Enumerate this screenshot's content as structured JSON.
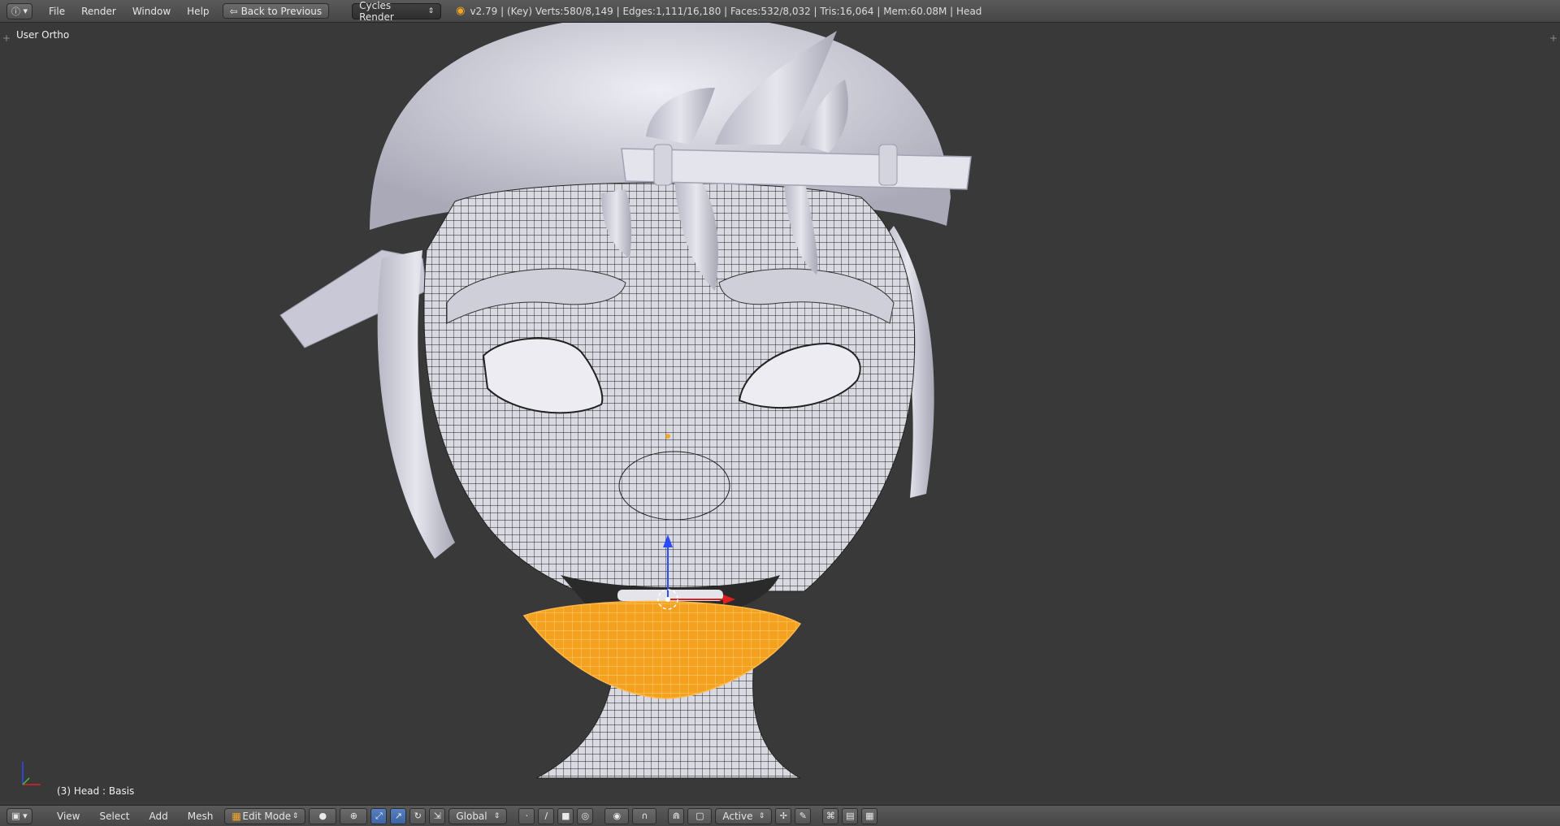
{
  "topbar": {
    "menus": [
      "File",
      "Render",
      "Window",
      "Help"
    ],
    "back_button": "Back to Previous",
    "render_engine": "Cycles Render",
    "stats": "v2.79 | (Key) Verts:580/8,149 | Edges:1,111/16,180 | Faces:532/8,032 | Tris:16,064 | Mem:60.08M | Head"
  },
  "viewport": {
    "view_label": "User Ortho",
    "object_label": "(3) Head : Basis"
  },
  "bottombar": {
    "menus": [
      "View",
      "Select",
      "Add",
      "Mesh"
    ],
    "mode": "Edit Mode",
    "orientation": "Global",
    "pivot_mode": "Active"
  },
  "colors": {
    "background": "#393939",
    "header": "#4b4b4b",
    "mesh": "#cfcfd9",
    "selection": "#f5a623",
    "axis_x": "#e02020",
    "axis_y": "#40c040",
    "axis_z": "#2a4bff"
  }
}
